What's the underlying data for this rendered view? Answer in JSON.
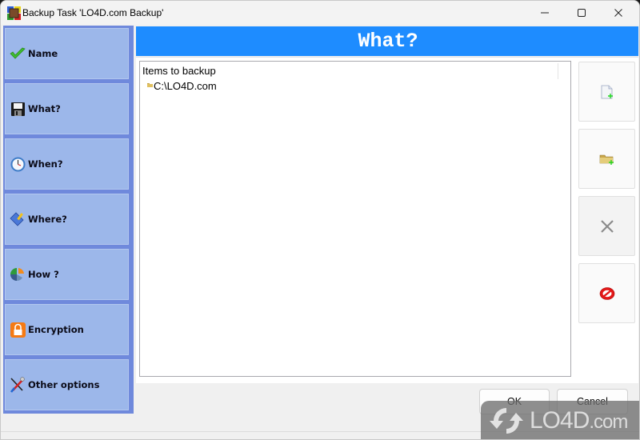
{
  "window": {
    "title": "Backup Task 'LO4D.com Backup'",
    "controls": {
      "minimize": "minimize",
      "maximize": "maximize",
      "close": "close"
    }
  },
  "sidebar": {
    "items": [
      {
        "label": "Name",
        "icon": "checkmark-icon"
      },
      {
        "label": "What?",
        "icon": "floppy-disk-icon"
      },
      {
        "label": "When?",
        "icon": "clock-icon"
      },
      {
        "label": "Where?",
        "icon": "drive-icon"
      },
      {
        "label": "How ?",
        "icon": "pie-chart-icon"
      },
      {
        "label": "Encryption",
        "icon": "lock-icon"
      },
      {
        "label": "Other options",
        "icon": "tools-icon"
      }
    ],
    "active_index": 1
  },
  "header": {
    "title": "What?"
  },
  "items_panel": {
    "column_header": "Items to backup",
    "items": [
      {
        "label": "C:\\LO4D.com",
        "icon": "folder-icon"
      }
    ]
  },
  "tool_buttons": [
    {
      "name": "add-file",
      "icon": "add-file-icon",
      "enabled": true
    },
    {
      "name": "add-folder",
      "icon": "add-folder-icon",
      "enabled": true
    },
    {
      "name": "remove",
      "icon": "remove-icon",
      "enabled": false
    },
    {
      "name": "exclude",
      "icon": "exclude-icon",
      "enabled": true
    }
  ],
  "footer": {
    "ok_label": "OK",
    "cancel_label": "Cancel"
  },
  "watermark": {
    "text_main": "LO4D",
    "text_suffix": ".com"
  },
  "colors": {
    "header_blue": "#1e8cff",
    "sidebar_frame": "#6f89dc",
    "sidebar_item": "#9cb7ea"
  }
}
